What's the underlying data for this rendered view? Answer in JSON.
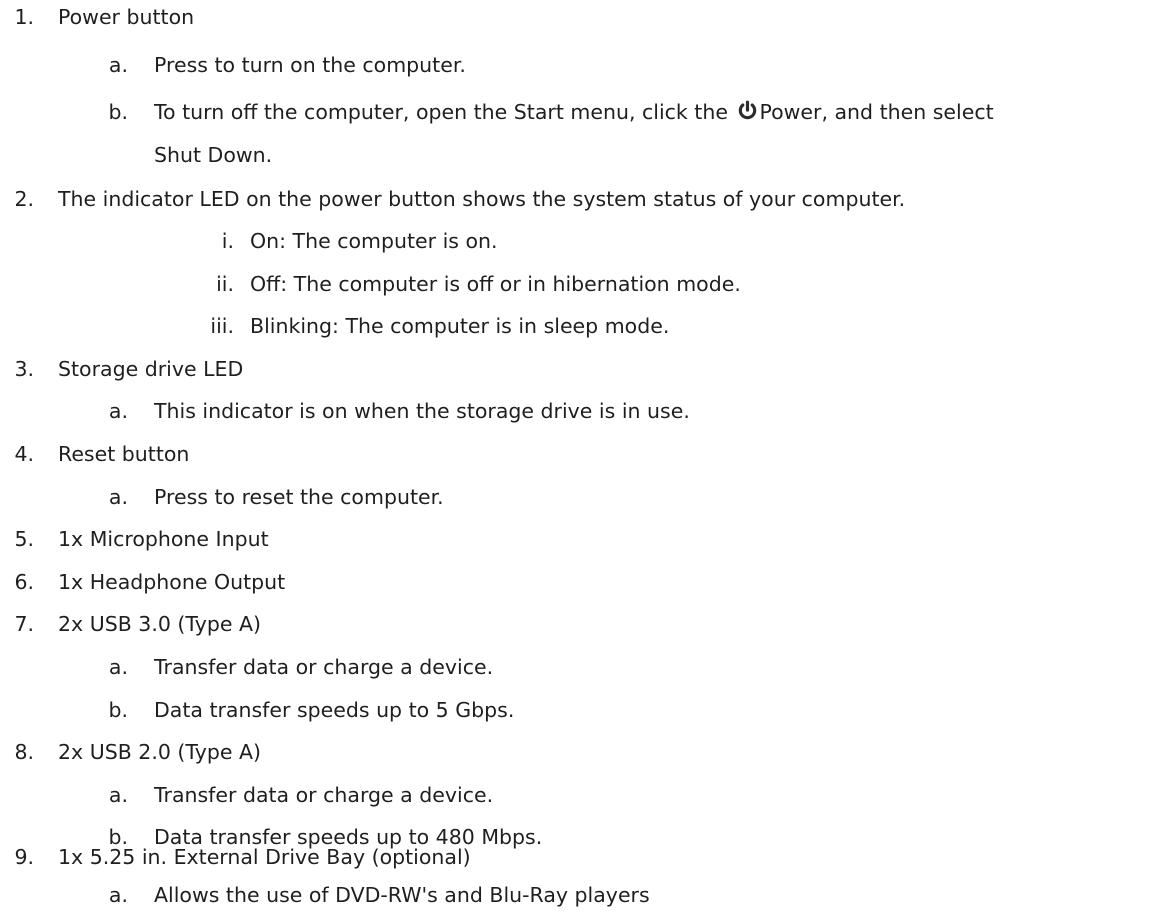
{
  "document": {
    "items": [
      {
        "marker": "1.",
        "text": "Power button",
        "sub": [
          {
            "marker": "a.",
            "text": "Press to turn on the computer."
          },
          {
            "marker": "b.",
            "text_before": "To turn off the computer, open the Start menu, click the ",
            "icon": "power-icon",
            "text_after": "Power, and then select",
            "continuation": "Shut Down."
          }
        ]
      },
      {
        "marker": "2.",
        "text": "The indicator LED on the power button shows the system status of your computer.",
        "sub": [
          {
            "marker": "i.",
            "text": "On: The computer is on."
          },
          {
            "marker": "ii.",
            "text": "Off: The computer is off or in hibernation mode."
          },
          {
            "marker": "iii.",
            "text": "Blinking: The computer is in sleep mode."
          }
        ]
      },
      {
        "marker": "3.",
        "text": "Storage drive LED",
        "sub": [
          {
            "marker": "a.",
            "text": "This indicator is on when the storage drive is in use."
          }
        ]
      },
      {
        "marker": "4.",
        "text": "Reset button",
        "sub": [
          {
            "marker": "a.",
            "text": "Press to reset the computer."
          }
        ]
      },
      {
        "marker": "5.",
        "text": "1x Microphone Input",
        "sub": []
      },
      {
        "marker": "6.",
        "text": "1x Headphone Output",
        "sub": []
      },
      {
        "marker": "7.",
        "text": "2x USB 3.0 (Type A)",
        "sub": [
          {
            "marker": "a.",
            "text": "Transfer data or charge a device."
          },
          {
            "marker": "b.",
            "text": "Data transfer speeds up to 5 Gbps."
          }
        ]
      },
      {
        "marker": "8.",
        "text": "2x USB 2.0 (Type A)",
        "sub": [
          {
            "marker": "a.",
            "text": "Transfer data or charge a device."
          },
          {
            "marker": "b.",
            "text": "Data transfer speeds up to 480 Mbps."
          }
        ]
      },
      {
        "marker": "9.",
        "text": "1x 5.25 in. External Drive Bay (optional)",
        "sub": [
          {
            "marker": "a.",
            "text": "Allows the use of DVD-RW's and Blu-Ray players"
          }
        ]
      }
    ]
  },
  "colors": {
    "text": "#1f1f1f",
    "icon": "#2b2b2b",
    "background": "#ffffff"
  }
}
